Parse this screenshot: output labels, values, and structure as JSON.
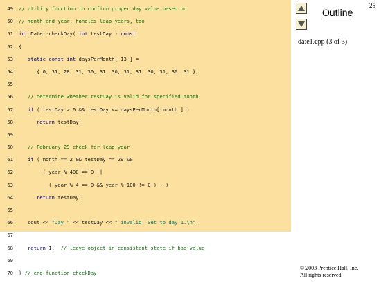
{
  "page_number": "25",
  "outline": {
    "label": "Outline"
  },
  "file_label": "date1.cpp (3 of 3)",
  "copyright": {
    "line1": "© 2003 Prentice Hall, Inc.",
    "line2": "All rights reserved."
  },
  "code_lines": [
    {
      "n": "49",
      "parts": [
        {
          "t": "// utility function to confirm proper day value based on",
          "c": "cm"
        }
      ]
    },
    {
      "n": "50",
      "parts": [
        {
          "t": "// month and year; handles leap years, too",
          "c": "cm"
        }
      ]
    },
    {
      "n": "51",
      "parts": [
        {
          "t": "int",
          "c": "kw"
        },
        {
          "t": " Date::checkDay( "
        },
        {
          "t": "int",
          "c": "kw"
        },
        {
          "t": " testDay ) "
        },
        {
          "t": "const",
          "c": "kw"
        }
      ]
    },
    {
      "n": "52",
      "parts": [
        {
          "t": "{"
        }
      ]
    },
    {
      "n": "53",
      "parts": [
        {
          "t": "   "
        },
        {
          "t": "static const int",
          "c": "kw"
        },
        {
          "t": " daysPerMonth[ 13 ] ="
        }
      ]
    },
    {
      "n": "54",
      "parts": [
        {
          "t": "      { 0, 31, 28, 31, 30, 31, 30, 31, 31, 30, 31, 30, 31 };"
        }
      ]
    },
    {
      "n": "55",
      "parts": [
        {
          "t": ""
        }
      ]
    },
    {
      "n": "56",
      "parts": [
        {
          "t": "   "
        },
        {
          "t": "// determine whether testDay is valid for specified month",
          "c": "cm"
        }
      ]
    },
    {
      "n": "57",
      "parts": [
        {
          "t": "   "
        },
        {
          "t": "if",
          "c": "kw"
        },
        {
          "t": " ( testDay > 0 && testDay <= daysPerMonth[ month ] )"
        }
      ]
    },
    {
      "n": "58",
      "parts": [
        {
          "t": "      "
        },
        {
          "t": "return",
          "c": "kw"
        },
        {
          "t": " testDay;"
        }
      ]
    },
    {
      "n": "59",
      "parts": [
        {
          "t": ""
        }
      ]
    },
    {
      "n": "60",
      "parts": [
        {
          "t": "   "
        },
        {
          "t": "// February 29 check for leap year",
          "c": "cm"
        }
      ]
    },
    {
      "n": "61",
      "parts": [
        {
          "t": "   "
        },
        {
          "t": "if",
          "c": "kw"
        },
        {
          "t": " ( month == 2 && testDay == 29 &&"
        }
      ]
    },
    {
      "n": "62",
      "parts": [
        {
          "t": "        ( year % 400 == 0 ||"
        }
      ]
    },
    {
      "n": "63",
      "parts": [
        {
          "t": "          ( year % 4 == 0 && year % 100 != 0 ) ) )"
        }
      ]
    },
    {
      "n": "64",
      "parts": [
        {
          "t": "      "
        },
        {
          "t": "return",
          "c": "kw"
        },
        {
          "t": " testDay;"
        }
      ]
    },
    {
      "n": "65",
      "parts": [
        {
          "t": ""
        }
      ]
    },
    {
      "n": "66",
      "parts": [
        {
          "t": "   cout << "
        },
        {
          "t": "\"Day \"",
          "c": "st"
        },
        {
          "t": " << testDay << "
        },
        {
          "t": "\" invalid. Set to day 1.\\n\"",
          "c": "st"
        },
        {
          "t": ";"
        }
      ]
    },
    {
      "n": "67",
      "parts": [
        {
          "t": ""
        }
      ]
    },
    {
      "n": "68",
      "parts": [
        {
          "t": "   "
        },
        {
          "t": "return",
          "c": "kw"
        },
        {
          "t": " 1;  "
        },
        {
          "t": "// leave object in consistent state if bad value",
          "c": "cm"
        }
      ]
    },
    {
      "n": "69",
      "parts": [
        {
          "t": ""
        }
      ]
    },
    {
      "n": "70",
      "parts": [
        {
          "t": "} "
        },
        {
          "t": "// end function checkDay",
          "c": "cm"
        }
      ]
    }
  ]
}
